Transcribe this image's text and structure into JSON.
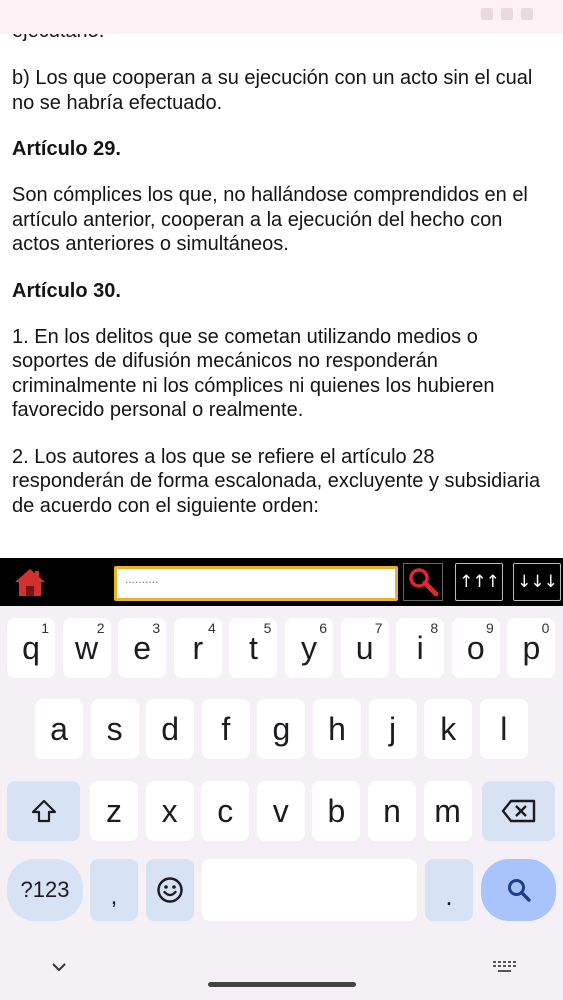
{
  "document": {
    "clipped_top": "ejecutario.",
    "blocks": [
      {
        "kind": "p",
        "text": "b) Los que cooperan a su ejecución con un acto sin el cual no se habría efectuado."
      },
      {
        "kind": "h",
        "text": "Artículo 29."
      },
      {
        "kind": "p",
        "text": "Son cómplices los que, no hallándose comprendidos en el artículo anterior, cooperan a la ejecución del hecho con actos anteriores o simultáneos."
      },
      {
        "kind": "h",
        "text": "Artículo 30."
      },
      {
        "kind": "p",
        "text": "1. En los delitos que se cometan utilizando medios o soportes de difusión mecánicos no responderán criminalmente ni los cómplices ni quienes los hubieren favorecido personal o realmente."
      },
      {
        "kind": "p",
        "text": "2. Los autores a los que se refiere el artículo 28 responderán de forma escalonada, excluyente y subsidiaria de acuerdo con el siguiente orden:"
      }
    ]
  },
  "toolbar": {
    "search_placeholder": "..........",
    "up_label": "↑↑↑",
    "down_label": "↓↓↓",
    "home_icon": "home-icon",
    "search_icon": "magnifier-icon"
  },
  "keyboard": {
    "row1": [
      {
        "key": "q",
        "num": "1"
      },
      {
        "key": "w",
        "num": "2"
      },
      {
        "key": "e",
        "num": "3"
      },
      {
        "key": "r",
        "num": "4"
      },
      {
        "key": "t",
        "num": "5"
      },
      {
        "key": "y",
        "num": "6"
      },
      {
        "key": "u",
        "num": "7"
      },
      {
        "key": "i",
        "num": "8"
      },
      {
        "key": "o",
        "num": "9"
      },
      {
        "key": "p",
        "num": "0"
      }
    ],
    "row2": [
      "a",
      "s",
      "d",
      "f",
      "g",
      "h",
      "j",
      "k",
      "l"
    ],
    "row3": [
      "z",
      "x",
      "c",
      "v",
      "b",
      "n",
      "m"
    ],
    "symbols_label": "?123",
    "comma_label": ",",
    "period_label": ".",
    "shift_icon": "shift-icon",
    "backspace_icon": "backspace-icon",
    "emoji_icon": "emoji-icon",
    "search_icon": "search-icon"
  },
  "colors": {
    "toolbar_bg": "#000000",
    "search_border": "#e7b32a",
    "home_red": "#d1322f",
    "accent_key": "#a9c4fb",
    "func_key": "#d8e2f5",
    "keyboard_bg": "#f5f0f6"
  }
}
